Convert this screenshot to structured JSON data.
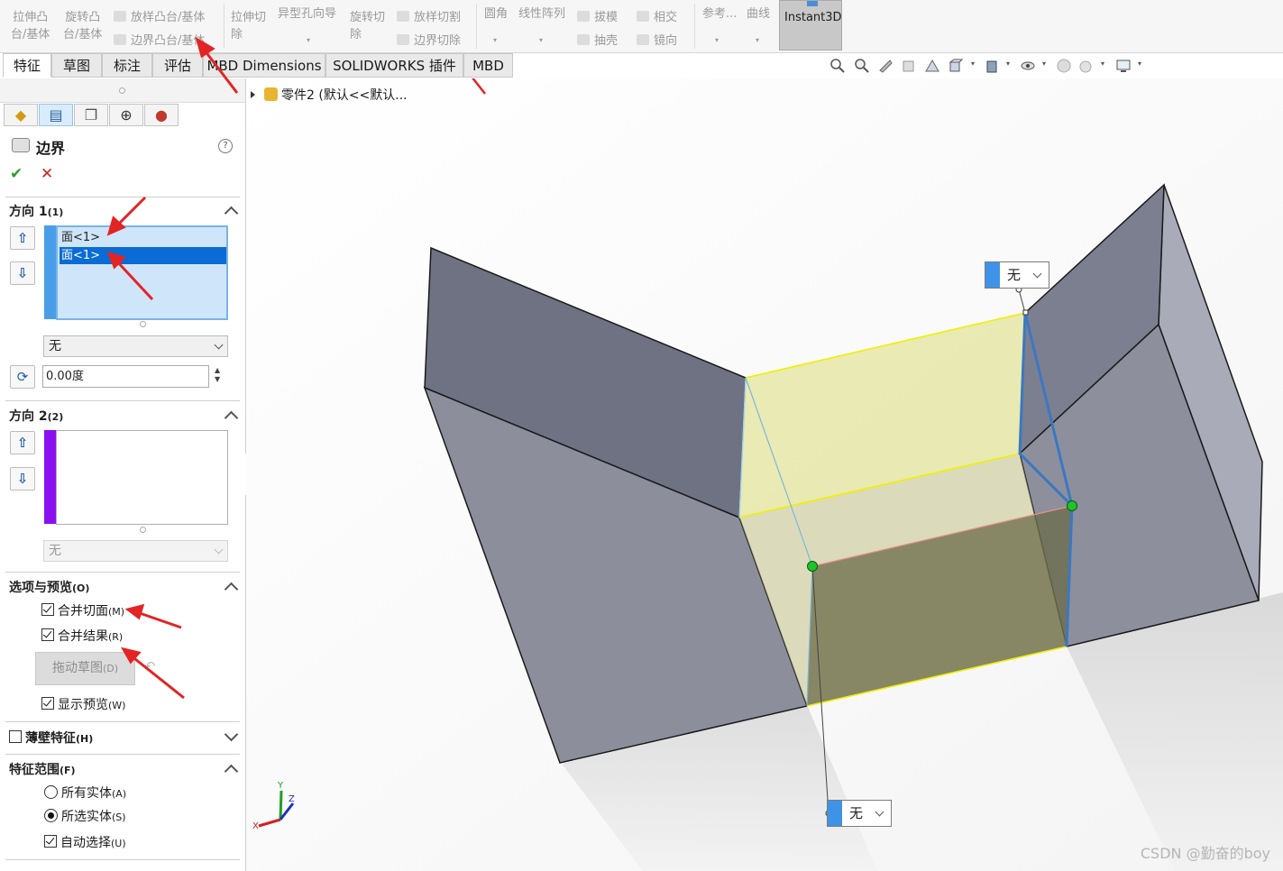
{
  "ribbon": {
    "items": [
      {
        "label": "拉伸凸\n台/基体"
      },
      {
        "label": "旋转凸\n台/基体"
      },
      {
        "label": "放样凸台/基体"
      },
      {
        "label": "边界凸台/基体"
      },
      {
        "label": "拉伸切\n除"
      },
      {
        "label": "异型孔向导"
      },
      {
        "label": "旋转切\n除"
      },
      {
        "label": "放样切割"
      },
      {
        "label": "边界切除"
      },
      {
        "label": "圆角"
      },
      {
        "label": "线性阵列"
      },
      {
        "label": "拔模"
      },
      {
        "label": "抽壳"
      },
      {
        "label": "相交"
      },
      {
        "label": "镜向"
      },
      {
        "label": "参考..."
      },
      {
        "label": "曲线"
      }
    ],
    "instant3d": "Instant3D"
  },
  "tabs": [
    "特征",
    "草图",
    "标注",
    "评估",
    "MBD Dimensions",
    "SOLIDWORKS 插件",
    "MBD"
  ],
  "active_tab": "特征",
  "feature_tree": {
    "root": "零件2 (默认<<默认..."
  },
  "panel": {
    "title": "边界",
    "help": "?",
    "ok": "✔",
    "cancel": "✕",
    "direction1": {
      "header": "方向 1",
      "count": "(1)",
      "items": [
        "面<1>",
        "面<1>"
      ],
      "selected_index": 1,
      "color": "#4a9ee8",
      "tangency": "无",
      "angle": "0.00度"
    },
    "direction2": {
      "header": "方向 2",
      "count": "(2)",
      "items": [],
      "color": "#8a10f0",
      "tangency": "无"
    },
    "options": {
      "header": "选项与预览",
      "hotkey": "(O)",
      "merge_tangent": {
        "label": "合并切面",
        "hotkey": "(M)",
        "checked": true
      },
      "merge_result": {
        "label": "合并结果",
        "hotkey": "(R)",
        "checked": true
      },
      "drag_sketch": {
        "label": "拖动草图",
        "hotkey": "(D)"
      },
      "show_preview": {
        "label": "显示预览",
        "hotkey": "(W)",
        "checked": true
      }
    },
    "thin_feature": {
      "label": "薄壁特征",
      "hotkey": "(H)",
      "checked": false
    },
    "feature_scope": {
      "header": "特征范围",
      "hotkey": "(F)",
      "all_bodies": {
        "label": "所有实体",
        "hotkey": "(A)",
        "checked": false
      },
      "selected_bodies": {
        "label": "所选实体",
        "hotkey": "(S)",
        "checked": true
      },
      "auto_select": {
        "label": "自动选择",
        "hotkey": "(U)",
        "checked": true
      }
    }
  },
  "callouts": {
    "top": "无",
    "bottom": "无"
  },
  "triad": {
    "x": "X",
    "y": "Y",
    "z": "Z"
  },
  "watermark": "CSDN @勤奋的boy",
  "colors": {
    "accent_blue": "#3f93e6",
    "selection": "#0a6cd4",
    "annotation_red": "#e32424",
    "boundary_preview": "#e8e89a",
    "preview_edge": "#f0f000"
  }
}
